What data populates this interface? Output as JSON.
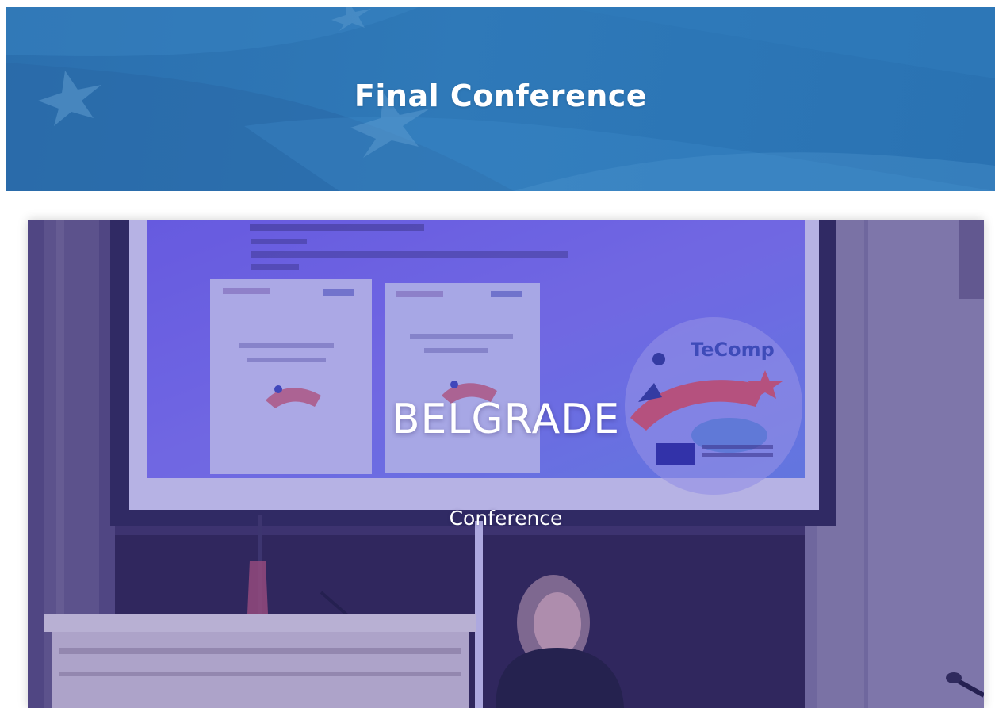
{
  "page": {
    "title": "Final Conference"
  },
  "event_card": {
    "title": "BELGRADE",
    "category": "Conference",
    "screen_logo_text": "TeComp"
  },
  "colors": {
    "banner_blue": "#2c74b4",
    "overlay_purple": "#4a3ec8",
    "text": "#ffffff"
  }
}
